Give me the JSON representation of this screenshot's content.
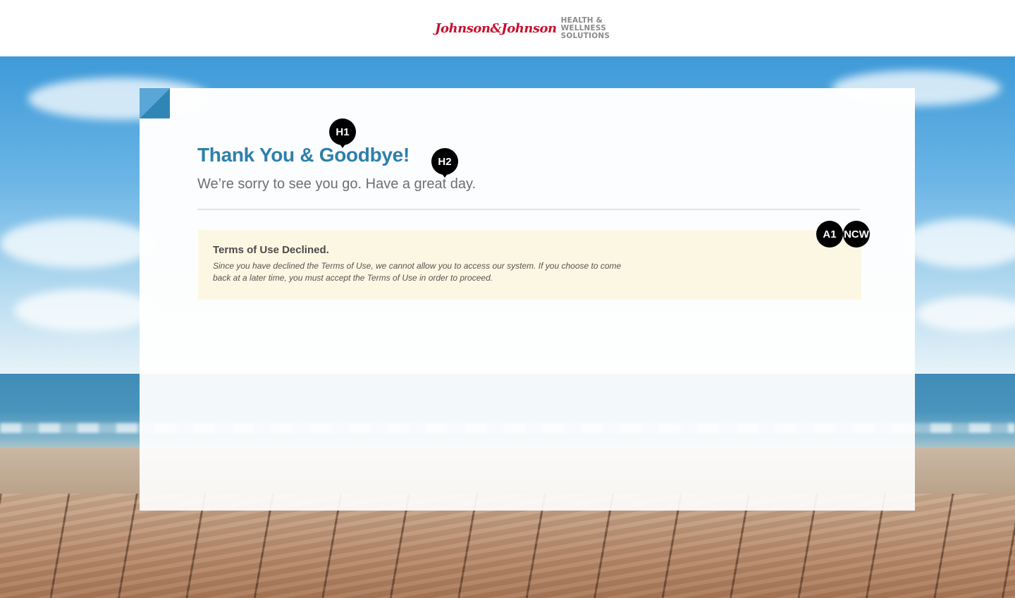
{
  "header": {
    "logo_script": "Johnson&Johnson",
    "logo_sub": [
      "HEALTH &",
      "WELLNESS",
      "SOLUTIONS"
    ]
  },
  "main": {
    "title": "Thank You & Goodbye!",
    "subtitle": "We’re sorry to see you go.  Have a great day.",
    "notice": {
      "title": "Terms of Use Declined.",
      "text": "Since you have declined the Terms of Use, we cannot allow you to access our system.  If you choose to come back at a later time, you must accept the Terms of Use in order to proceed."
    }
  },
  "badges": {
    "h1": "H1",
    "h2": "H2",
    "a1": "A1",
    "ncw": "NCW"
  },
  "colors": {
    "accent": "#2e7fab",
    "logo_red": "#c8102e",
    "notice_bg": "#fcf7e2",
    "fold": "#2f86b6"
  }
}
